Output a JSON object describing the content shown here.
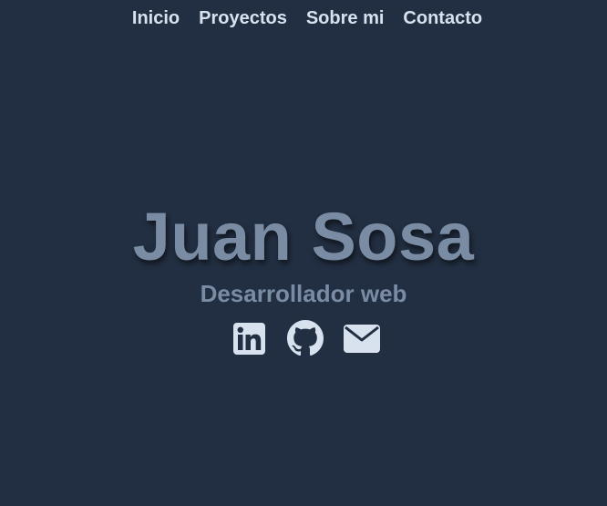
{
  "nav": {
    "items": [
      {
        "label": "Inicio"
      },
      {
        "label": "Proyectos"
      },
      {
        "label": "Sobre mi"
      },
      {
        "label": "Contacto"
      }
    ]
  },
  "hero": {
    "name": "Juan Sosa",
    "subtitle": "Desarrollador web"
  },
  "social": {
    "icons": [
      "linkedin-icon",
      "github-icon",
      "email-icon"
    ]
  },
  "colors": {
    "background": "#222f42",
    "nav_text": "#d8e2ef",
    "hero_text": "#7a8ca3",
    "icon_fill": "#d8e2ef"
  }
}
